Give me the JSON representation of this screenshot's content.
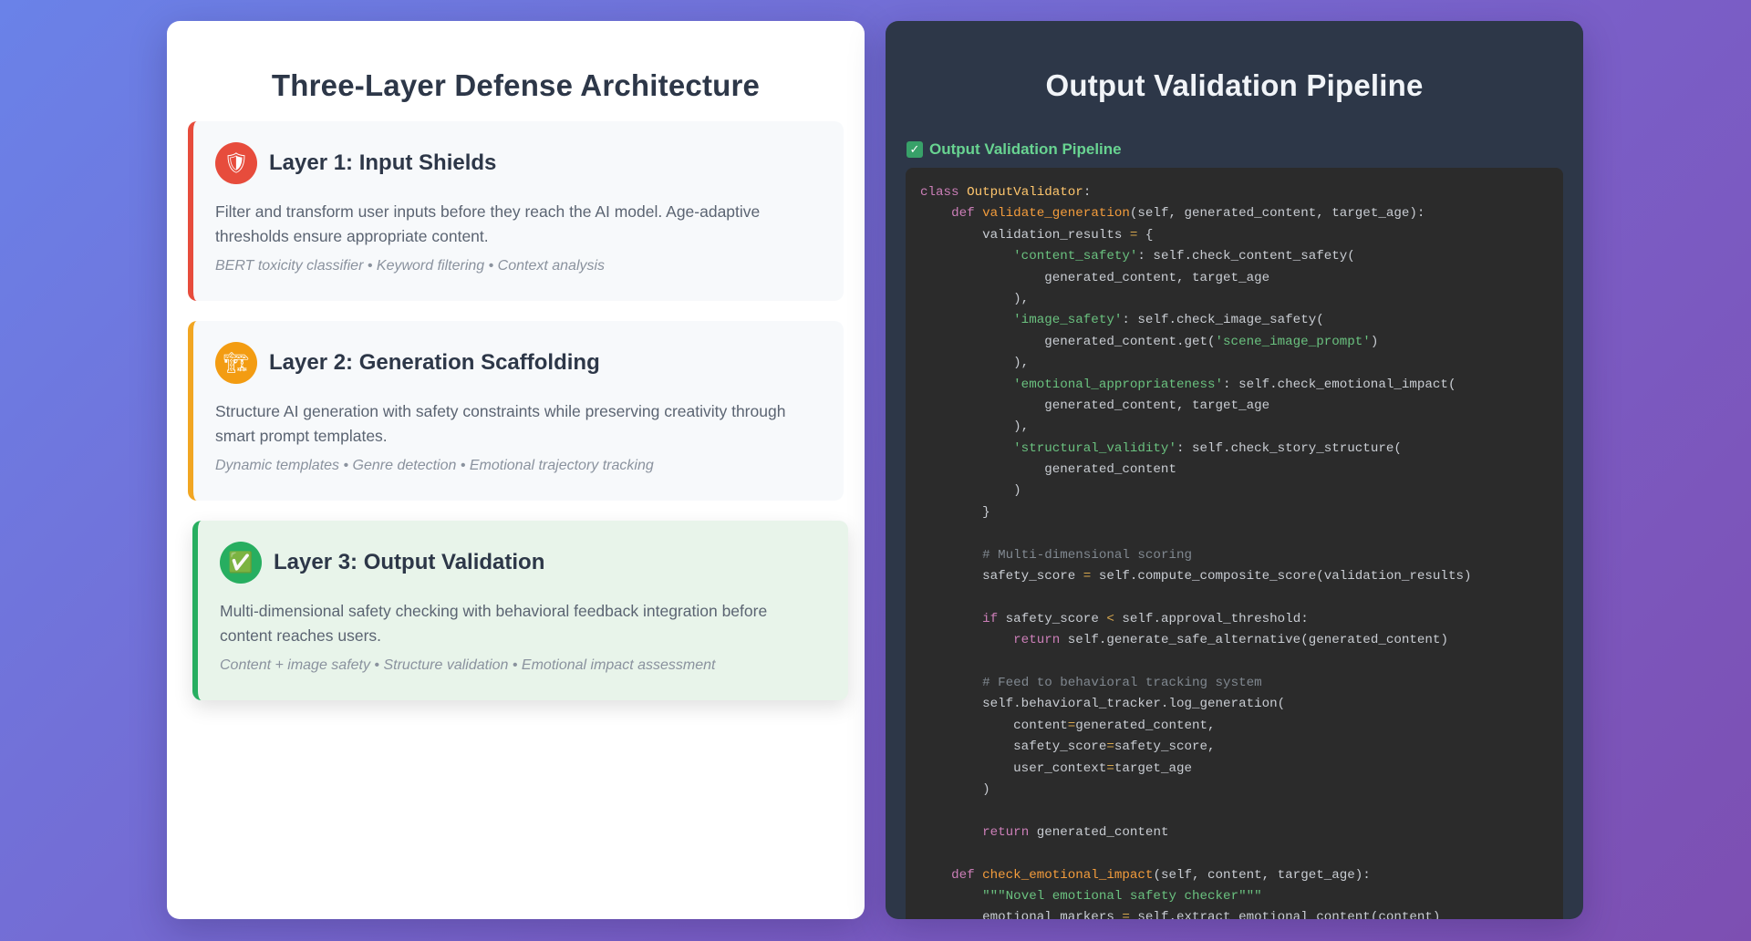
{
  "left_panel": {
    "title": "Three-Layer Defense Architecture",
    "layers": [
      {
        "icon": "shield-icon",
        "glyph": "🛡",
        "title": "Layer 1: Input Shields",
        "description": "Filter and transform user inputs before they reach the AI model. Age-adaptive thresholds ensure appropriate content.",
        "tags": "BERT toxicity classifier • Keyword filtering • Context analysis",
        "accent": "#e74c3c"
      },
      {
        "icon": "construction-crane-icon",
        "glyph": "🏗",
        "title": "Layer 2: Generation Scaffolding",
        "description": "Structure AI generation with safety constraints while preserving creativity through smart prompt templates.",
        "tags": "Dynamic templates • Genre detection • Emotional trajectory tracking",
        "accent": "#f1a622"
      },
      {
        "icon": "check-mark-icon",
        "glyph": "✅",
        "title": "Layer 3: Output Validation",
        "description": "Multi-dimensional safety checking with behavioral feedback integration before content reaches users.",
        "tags": "Content + image safety • Structure validation • Emotional impact assessment",
        "accent": "#27ae60"
      }
    ]
  },
  "right_panel": {
    "title": "Output Validation Pipeline",
    "code_label": "Output Validation Pipeline",
    "code_label_icon": "check-mark-icon",
    "code_lines": [
      [
        [
          "kw",
          "class "
        ],
        [
          "cls",
          "OutputValidator"
        ],
        [
          "pl",
          ":"
        ]
      ],
      [
        [
          "pl",
          "    "
        ],
        [
          "kw",
          "def "
        ],
        [
          "fn",
          "validate_generation"
        ],
        [
          "pl",
          "(self, generated_content, target_age):"
        ]
      ],
      [
        [
          "pl",
          "        validation_results "
        ],
        [
          "op",
          "="
        ],
        [
          "pl",
          " {"
        ]
      ],
      [
        [
          "pl",
          "            "
        ],
        [
          "str",
          "'content_safety'"
        ],
        [
          "pl",
          ": self.check_content_safety("
        ]
      ],
      [
        [
          "pl",
          "                generated_content, target_age"
        ]
      ],
      [
        [
          "pl",
          "            ),"
        ]
      ],
      [
        [
          "pl",
          "            "
        ],
        [
          "str",
          "'image_safety'"
        ],
        [
          "pl",
          ": self.check_image_safety("
        ]
      ],
      [
        [
          "pl",
          "                generated_content.get("
        ],
        [
          "str",
          "'scene_image_prompt'"
        ],
        [
          "pl",
          ")"
        ]
      ],
      [
        [
          "pl",
          "            ),"
        ]
      ],
      [
        [
          "pl",
          "            "
        ],
        [
          "str",
          "'emotional_appropriateness'"
        ],
        [
          "pl",
          ": self.check_emotional_impact("
        ]
      ],
      [
        [
          "pl",
          "                generated_content, target_age"
        ]
      ],
      [
        [
          "pl",
          "            ),"
        ]
      ],
      [
        [
          "pl",
          "            "
        ],
        [
          "str",
          "'structural_validity'"
        ],
        [
          "pl",
          ": self.check_story_structure("
        ]
      ],
      [
        [
          "pl",
          "                generated_content"
        ]
      ],
      [
        [
          "pl",
          "            )"
        ]
      ],
      [
        [
          "pl",
          "        }"
        ]
      ],
      [
        [
          "pl",
          ""
        ]
      ],
      [
        [
          "pl",
          "        "
        ],
        [
          "cm",
          "# Multi-dimensional scoring"
        ]
      ],
      [
        [
          "pl",
          "        safety_score "
        ],
        [
          "op",
          "="
        ],
        [
          "pl",
          " self.compute_composite_score(validation_results)"
        ]
      ],
      [
        [
          "pl",
          ""
        ]
      ],
      [
        [
          "pl",
          "        "
        ],
        [
          "kw",
          "if"
        ],
        [
          "pl",
          " safety_score "
        ],
        [
          "op",
          "<"
        ],
        [
          "pl",
          " self.approval_threshold:"
        ]
      ],
      [
        [
          "pl",
          "            "
        ],
        [
          "kw",
          "return"
        ],
        [
          "pl",
          " self.generate_safe_alternative(generated_content)"
        ]
      ],
      [
        [
          "pl",
          ""
        ]
      ],
      [
        [
          "pl",
          "        "
        ],
        [
          "cm",
          "# Feed to behavioral tracking system"
        ]
      ],
      [
        [
          "pl",
          "        self.behavioral_tracker.log_generation("
        ]
      ],
      [
        [
          "pl",
          "            content"
        ],
        [
          "op",
          "="
        ],
        [
          "pl",
          "generated_content,"
        ]
      ],
      [
        [
          "pl",
          "            safety_score"
        ],
        [
          "op",
          "="
        ],
        [
          "pl",
          "safety_score,"
        ]
      ],
      [
        [
          "pl",
          "            user_context"
        ],
        [
          "op",
          "="
        ],
        [
          "pl",
          "target_age"
        ]
      ],
      [
        [
          "pl",
          "        )"
        ]
      ],
      [
        [
          "pl",
          ""
        ]
      ],
      [
        [
          "pl",
          "        "
        ],
        [
          "kw",
          "return"
        ],
        [
          "pl",
          " generated_content"
        ]
      ],
      [
        [
          "pl",
          ""
        ]
      ],
      [
        [
          "pl",
          "    "
        ],
        [
          "kw",
          "def "
        ],
        [
          "fn",
          "check_emotional_impact"
        ],
        [
          "pl",
          "(self, content, target_age):"
        ]
      ],
      [
        [
          "pl",
          "        "
        ],
        [
          "str",
          "\"\"\"Novel emotional safety checker\"\"\""
        ]
      ],
      [
        [
          "pl",
          "        emotional_markers "
        ],
        [
          "op",
          "="
        ],
        [
          "pl",
          " self.extract_emotional_content(content)"
        ]
      ]
    ]
  }
}
